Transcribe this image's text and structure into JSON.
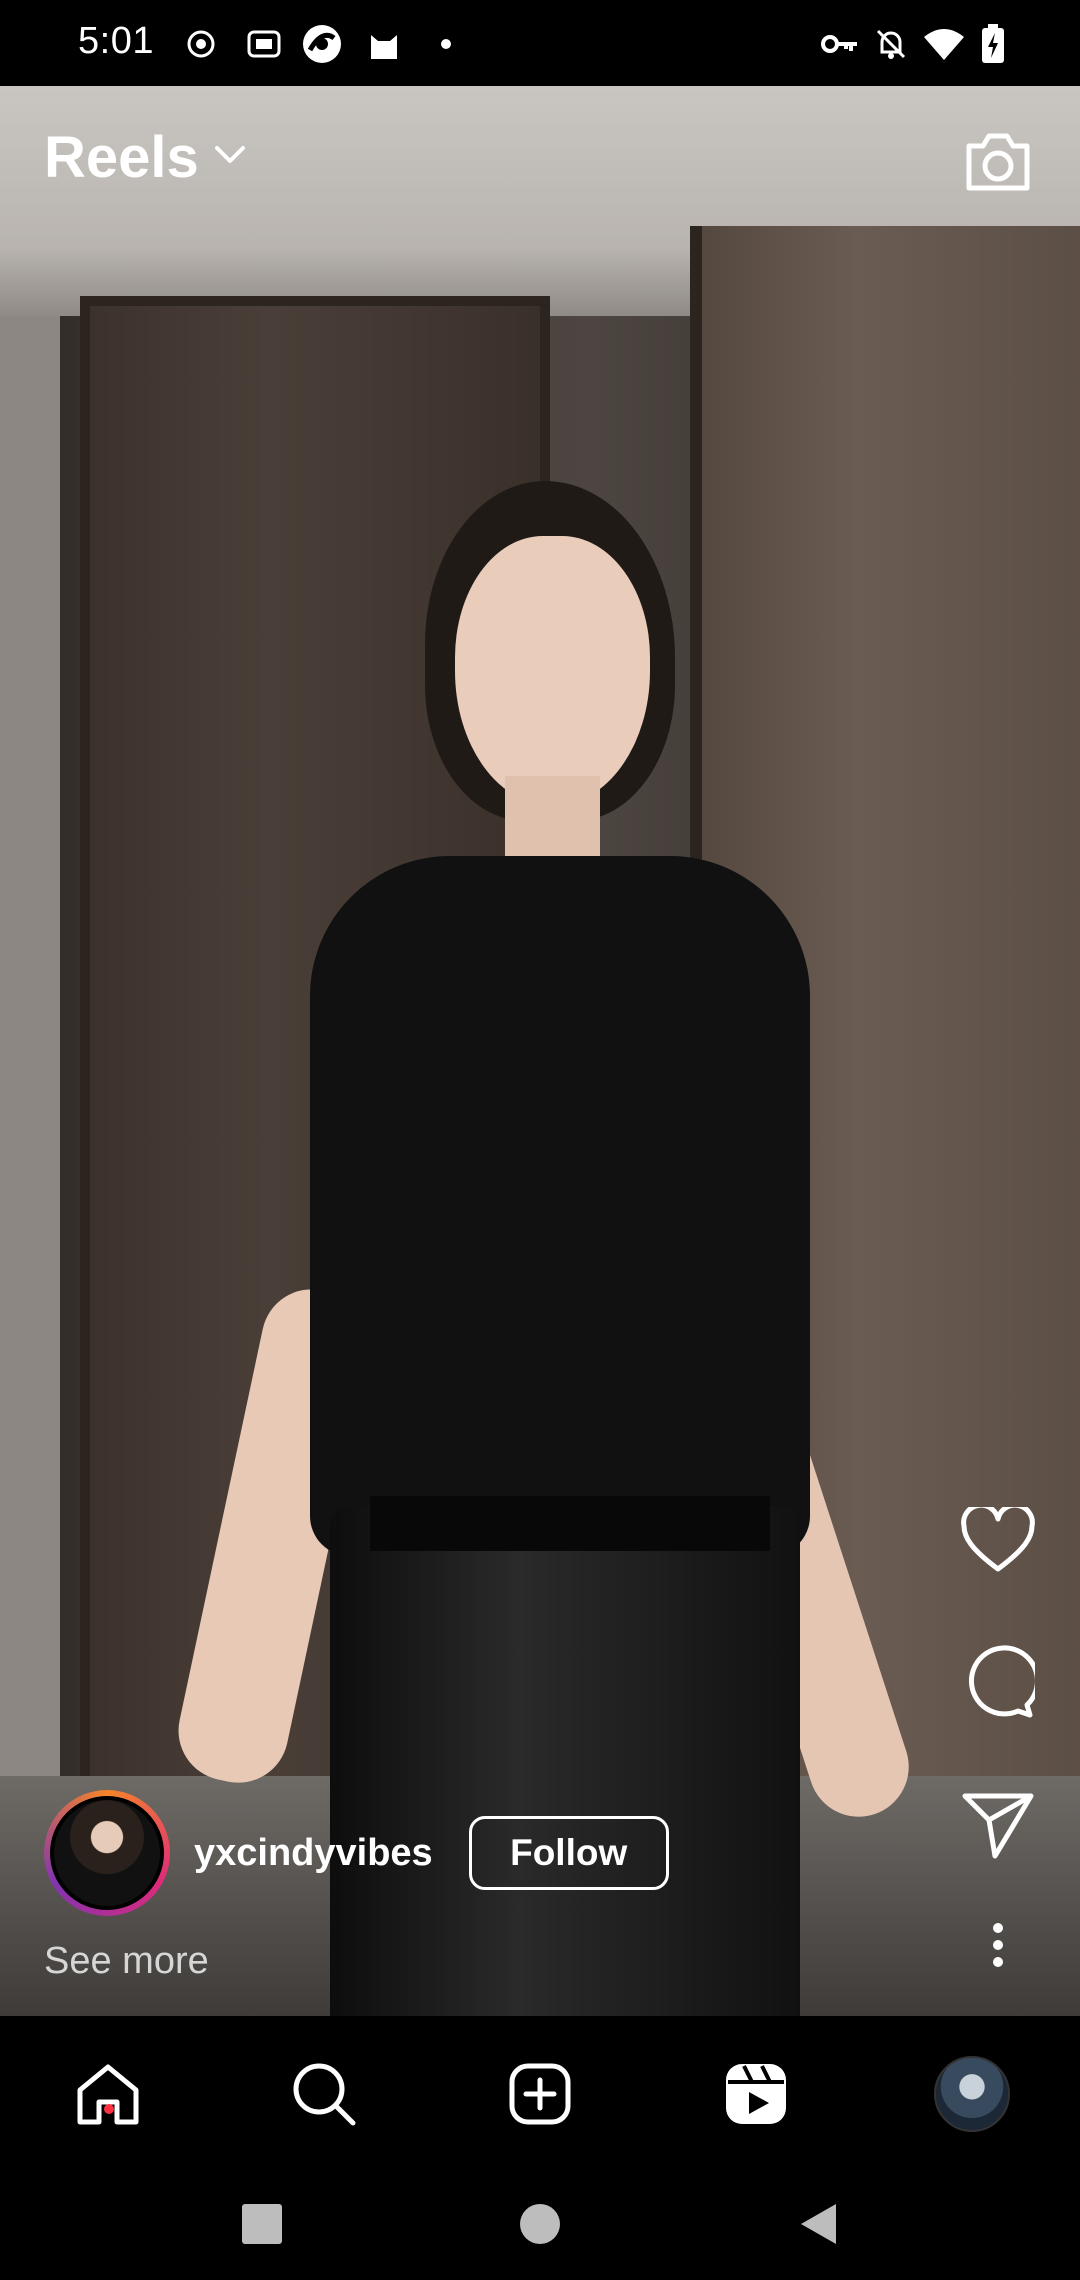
{
  "status_bar": {
    "time": "5:01",
    "left_icons": [
      "record-icon",
      "iqiyi-icon",
      "browser-icon",
      "cat-icon",
      "dot-icon"
    ],
    "right_icons": [
      "vpn-key-icon",
      "bell-off-icon",
      "wifi-icon",
      "battery-charging-icon"
    ]
  },
  "header": {
    "title": "Reels"
  },
  "reel": {
    "username": "yxcindyvibes",
    "follow_label": "Follow",
    "see_more": "See more"
  },
  "actions": [
    "like-heart-icon",
    "comment-icon",
    "share-send-icon",
    "more-options-icon"
  ],
  "bottom_nav": [
    "home-icon",
    "search-icon",
    "create-icon",
    "reels-icon",
    "profile-avatar"
  ],
  "system_nav": [
    "recents-icon",
    "home-circle-icon",
    "back-icon"
  ],
  "colors": {
    "notification_dot": "#ff3040",
    "background": "#000000",
    "text": "#ffffff"
  }
}
